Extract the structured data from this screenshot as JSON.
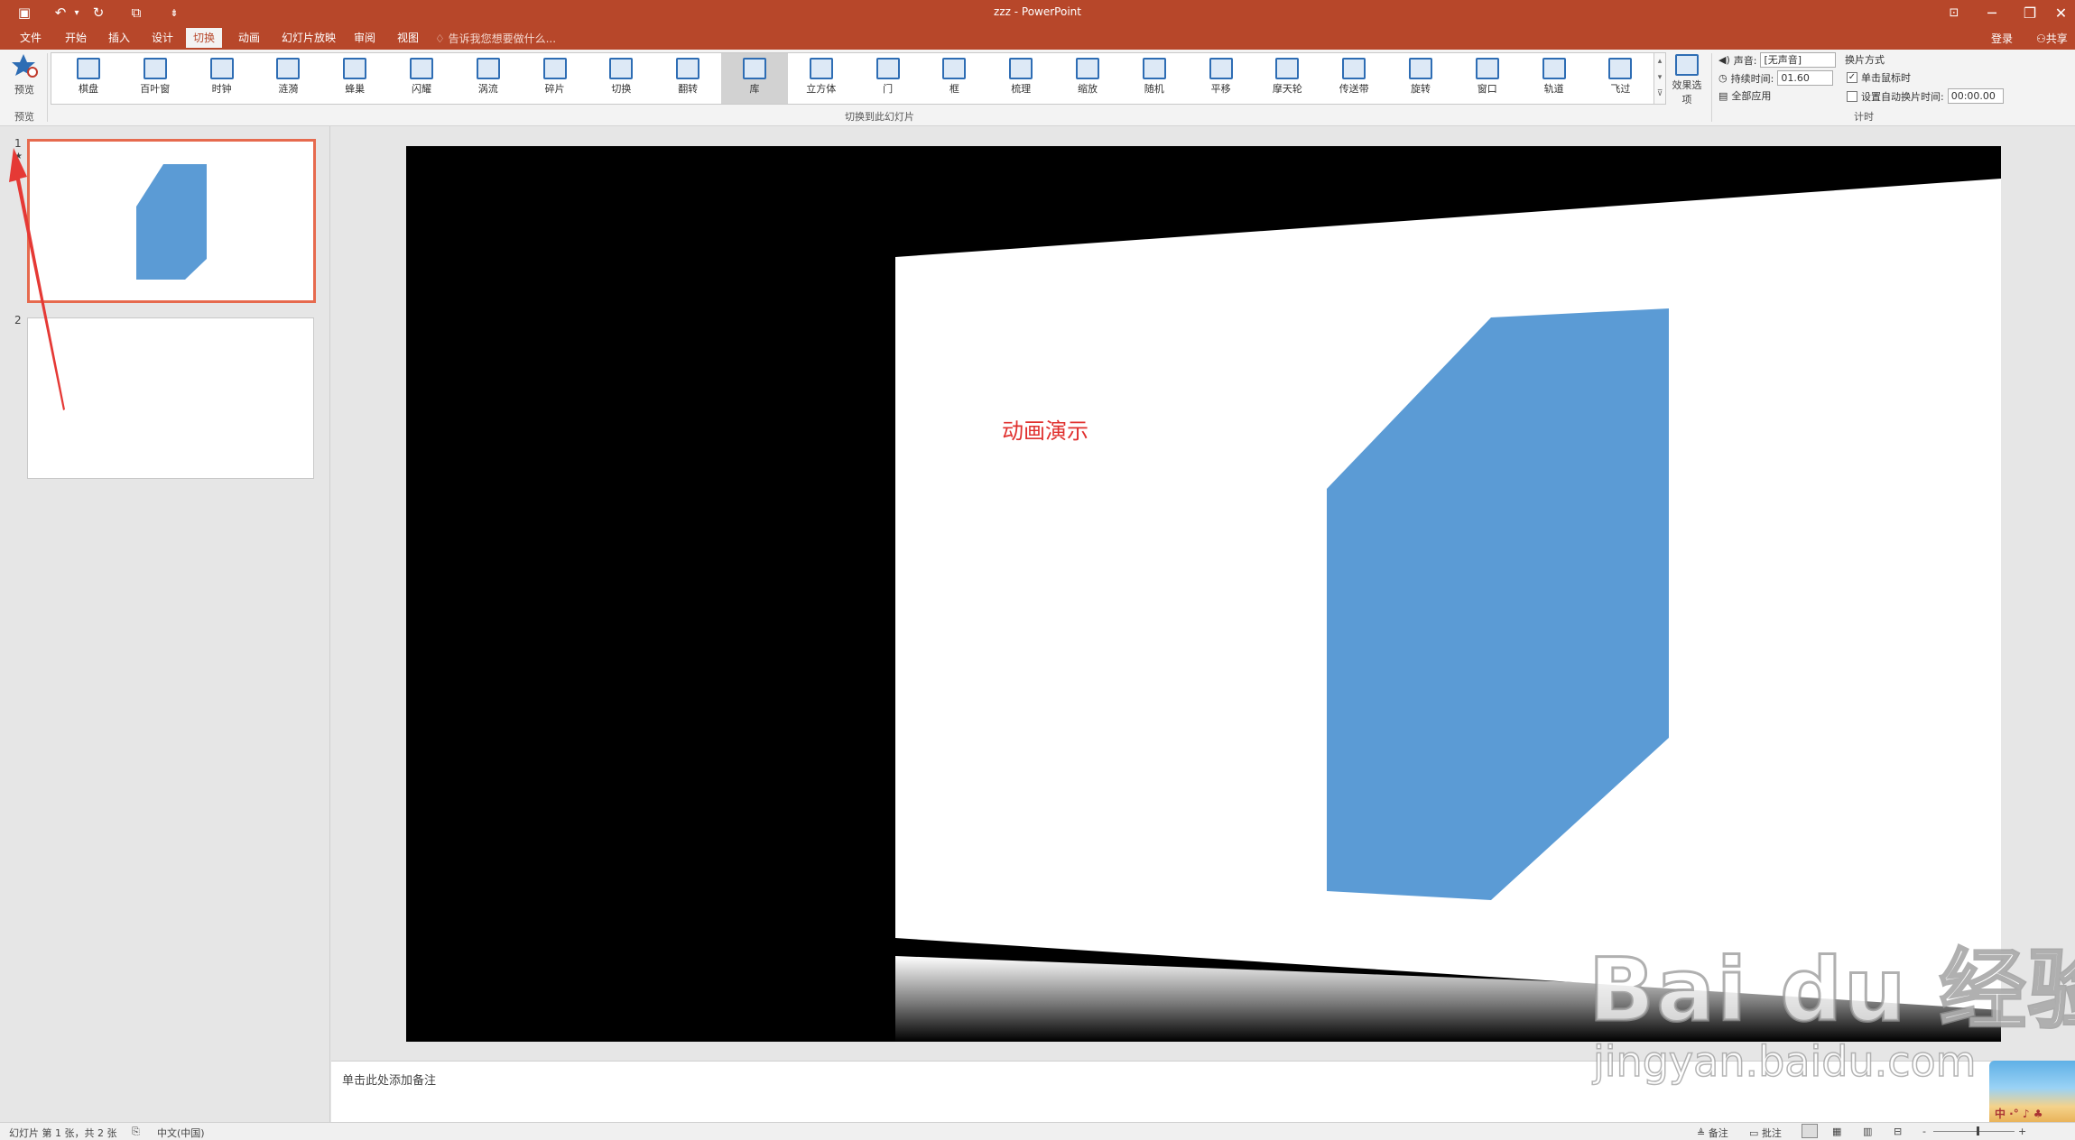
{
  "window": {
    "title": "zzz - PowerPoint",
    "minimize": "─",
    "restore": "❐",
    "close": "✕",
    "ribbon_display": "⊡"
  },
  "qat": {
    "save_icon": "▣",
    "undo_icon": "↶",
    "undo_dropdown": "▾",
    "redo_icon": "↻",
    "from_start_icon": "⧉",
    "customize_icon": "⇟"
  },
  "tabs": [
    {
      "label": "文件"
    },
    {
      "label": "开始"
    },
    {
      "label": "插入"
    },
    {
      "label": "设计"
    },
    {
      "label": "切换"
    },
    {
      "label": "动画"
    },
    {
      "label": "幻灯片放映"
    },
    {
      "label": "审阅"
    },
    {
      "label": "视图"
    }
  ],
  "tell_me": "告诉我您想要做什么...",
  "account": {
    "signin": "登录",
    "share": "共享"
  },
  "ribbon": {
    "preview_label": "预览",
    "preview_group": "预览",
    "transitions_group": "切换到此幻灯片",
    "timing_group": "计时",
    "effect_options": "效果选项",
    "gallery_scroll": [
      "▴",
      "▾",
      "⊽"
    ],
    "transitions": [
      {
        "label": "棋盘"
      },
      {
        "label": "百叶窗"
      },
      {
        "label": "时钟"
      },
      {
        "label": "涟漪"
      },
      {
        "label": "蜂巢"
      },
      {
        "label": "闪耀"
      },
      {
        "label": "涡流"
      },
      {
        "label": "碎片"
      },
      {
        "label": "切换"
      },
      {
        "label": "翻转"
      },
      {
        "label": "库"
      },
      {
        "label": "立方体"
      },
      {
        "label": "门"
      },
      {
        "label": "框"
      },
      {
        "label": "梳理"
      },
      {
        "label": "缩放"
      },
      {
        "label": "随机"
      },
      {
        "label": "平移"
      },
      {
        "label": "摩天轮"
      },
      {
        "label": "传送带"
      },
      {
        "label": "旋转"
      },
      {
        "label": "窗口"
      },
      {
        "label": "轨道"
      },
      {
        "label": "飞过"
      }
    ],
    "timing": {
      "sound_label": "声音:",
      "sound_value": "[无声音]",
      "duration_label": "持续时间:",
      "duration_value": "01.60",
      "apply_all": "全部应用",
      "advance_heading": "换片方式",
      "on_click_label": "单击鼠标时",
      "on_click_checked": "✓",
      "after_label": "设置自动换片时间:",
      "after_value": "00:00.00"
    }
  },
  "slides": [
    {
      "number": "1",
      "marker": "★"
    },
    {
      "number": "2"
    }
  ],
  "slide_text": "动画演示",
  "notes_placeholder": "单击此处添加备注",
  "status": {
    "slide_info": "幻灯片 第 1 张，共 2 张",
    "language": "中文(中国)",
    "notes": "备注",
    "comments": "批注",
    "zoom_minus": "-",
    "zoom_plus": "+"
  },
  "watermark": {
    "logo": "Bai du 经验",
    "url": "jingyan.baidu.com",
    "corner_text": "中 ·° ♪ ♣"
  },
  "colors": {
    "accent": "#b7472a",
    "shape": "#5b9bd5",
    "text_red": "#e0302e",
    "selection": "#e66a4e"
  }
}
